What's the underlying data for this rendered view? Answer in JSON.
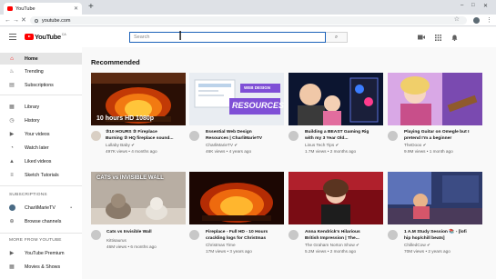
{
  "browser": {
    "tab_title": "YouTube",
    "url": "youtube.com",
    "new_tab": "+",
    "win_min": "–",
    "win_max": "□",
    "win_close": "✕",
    "tab_close": "✕",
    "back": "←",
    "forward": "→",
    "reload": "⟳",
    "star": "☆",
    "menu": "⋮"
  },
  "masthead": {
    "logo_text": "YouTube",
    "logo_region": "CA",
    "search_placeholder": "Search",
    "search_icon": "🔍",
    "create_icon": "⏺",
    "apps_icon": "⋮⋮",
    "bell_icon": "🔔"
  },
  "sidebar": {
    "items": [
      {
        "label": "Home",
        "icon": "home-icon",
        "glyph": "⌂"
      },
      {
        "label": "Trending",
        "icon": "flame-icon",
        "glyph": "♨"
      },
      {
        "label": "Subscriptions",
        "icon": "subscriptions-icon",
        "glyph": "▤"
      },
      {
        "label": "Library",
        "icon": "library-icon",
        "glyph": "▦"
      },
      {
        "label": "History",
        "icon": "history-icon",
        "glyph": "◷"
      },
      {
        "label": "Your videos",
        "icon": "your-videos-icon",
        "glyph": "▶"
      },
      {
        "label": "Watch later",
        "icon": "clock-icon",
        "glyph": "◔"
      },
      {
        "label": "Liked videos",
        "icon": "thumb-up-icon",
        "glyph": "👍"
      },
      {
        "label": "Sketch Tutorials",
        "icon": "playlist-icon",
        "glyph": "≡"
      }
    ],
    "subscriptions_header": "SUBSCRIPTIONS",
    "subscription": {
      "label": "CharliMarieTV",
      "dot": "•"
    },
    "browse_channels": {
      "label": "Browse channels",
      "glyph": "⊕"
    },
    "more_header": "MORE FROM YOUTUBE",
    "more_items": [
      {
        "label": "YouTube Premium",
        "glyph": "▶"
      },
      {
        "label": "Movies & Shows",
        "glyph": "▦"
      }
    ]
  },
  "main": {
    "section_title": "Recommended",
    "videos": [
      {
        "title1": "✰10 HOURS ✰ Fireplace",
        "title2": "Burning ✰ HQ fireplace sound...",
        "channel": "Lullaby Baby ✔",
        "meta": "497K views • 4 months ago",
        "thumb_text": "10 hours   HD 1080p"
      },
      {
        "title1": "Essential Web Design",
        "title2": "Resources | CharliMarieTV",
        "channel": "CharliMarieTV ✔",
        "meta": "46K views • 4 years ago",
        "thumb_text": "RESOURCES",
        "thumb_sub": "WEB DESIGN"
      },
      {
        "title1": "Building a BEAST Gaming Rig",
        "title2": "with my 3 Year Old...",
        "channel": "Linus Tech Tips ✔",
        "meta": "1.7M views • 2 months ago",
        "thumb_text": ""
      },
      {
        "title1": "Playing Guitar on Omegle but I",
        "title2": "pretend I'm a beginner",
        "channel": "TheDooo ✔",
        "meta": "9.9M views • 1 month ago",
        "thumb_text": ""
      },
      {
        "title1": "Cats vs Invisible Wall",
        "title2": "",
        "channel": "Kittisaurus",
        "meta": "46M views • 6 months ago",
        "thumb_text": "CATS vs INVISIBLE WALL"
      },
      {
        "title1": "Fireplace - Full HD - 10 Hours",
        "title2": "crackling logs for Christmas",
        "channel": "Christmas Time",
        "meta": "17M views • 3 years ago",
        "thumb_text": ""
      },
      {
        "title1": "Anna Kendrick's Hilarious",
        "title2": "British Impression | The...",
        "channel": "The Graham Norton Show ✔",
        "meta": "5.2M views • 2 months ago",
        "thumb_text": ""
      },
      {
        "title1": "1 A.M Study Session 📚 - [lofi",
        "title2": "hip hop/chill beats]",
        "channel": "ChilledCow ✔",
        "meta": "70M views • 2 years ago",
        "thumb_text": ""
      }
    ]
  }
}
